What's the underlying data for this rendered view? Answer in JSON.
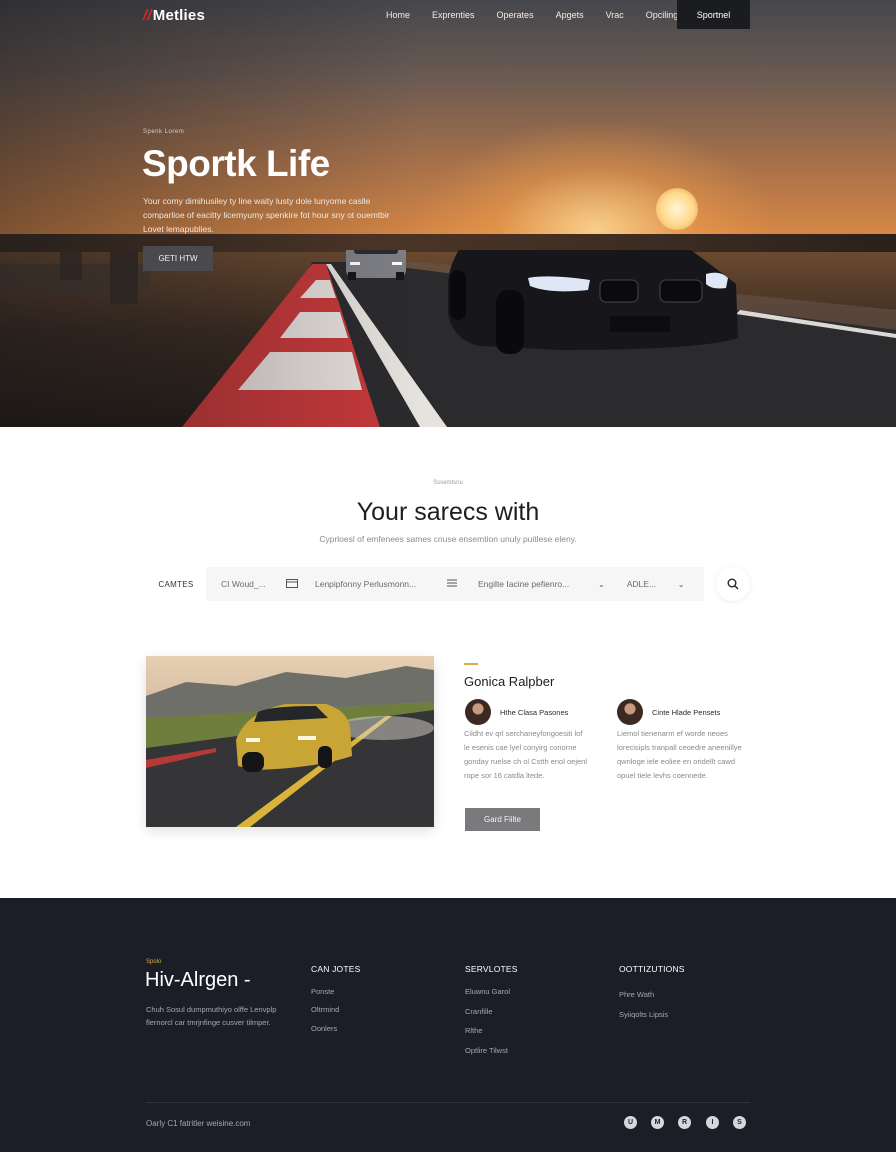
{
  "nav": {
    "logo": "Metlies",
    "links": [
      "Home",
      "Exprenties",
      "Operates",
      "Apgets",
      "Vrac",
      "Opciling"
    ],
    "cta": "Sportnel"
  },
  "hero": {
    "eyebrow": "Spenk Lorem",
    "title": "Sportk Life",
    "description": "Your comy dimihusiley ty line waity lusty dole lunyome caslle comparlioe of eacitty licemyumy spenkire fot hour sny ot ouemtbir Lovet lemapublies.",
    "button": "GETI HTW"
  },
  "search_section": {
    "eyebrow": "Sssemtsnu",
    "title": "Your sarecs with",
    "subtitle": "Cyprloesl of emfenees sames cnuse ensemtion unuly puitlese eleny.",
    "category_label": "CAMTES",
    "fields": [
      "CI Woud_...",
      "Lenpipfonny Perlusmonn...",
      "Engilte Iacine pefienro...",
      "ADLE..."
    ]
  },
  "feature": {
    "title": "Gonica Ralpber",
    "people": [
      {
        "name": "Hthe Clasa Pasones",
        "quote": "Cildht ev qrl serchaneyfongoesiti lof le esenis cae lyel conyirg conorne gonday ruelse ch ol Cstth enol oejenl rope sor 16 catdla ltede."
      },
      {
        "name": "Cinte Hlade Pensets",
        "quote": "Liemol tienenarm ef worde neoes lorecisipls tranpall ceoedre aneenillye qwnloge iele eoliee en oridellt cawd opuel tiele levhs coennede."
      }
    ],
    "button": "Gard Fiilte"
  },
  "footer": {
    "eyebrow": "Spolo",
    "brand": "Hiv-Alrgen -",
    "description": "Chuh Sosul dumpmuthiyo olffe Lenvplp flernorcl car tmrjnfinge cusver tilmper.",
    "columns": [
      {
        "title": "CAN JOTES",
        "links": [
          "Ponste",
          "Oltrmind",
          "Oonlers"
        ]
      },
      {
        "title": "SERVLOTES",
        "links": [
          "Eluwnu Garol",
          "Cranfille",
          "Rlthe",
          "Optlire Tilwst"
        ]
      },
      {
        "title": "OOTTIZUTIONS",
        "links": [
          "Phre Wath",
          "Syiiqolts Lipsis"
        ]
      }
    ],
    "copyright": "Oarly C1 fatritler weisine.com",
    "social": [
      "U",
      "M",
      "R",
      "I",
      "S"
    ]
  },
  "colors": {
    "accent": "#d9262a",
    "gold": "#e0a84a",
    "footer_bg": "#1b1e27",
    "dark_button": "#1b1c20"
  }
}
